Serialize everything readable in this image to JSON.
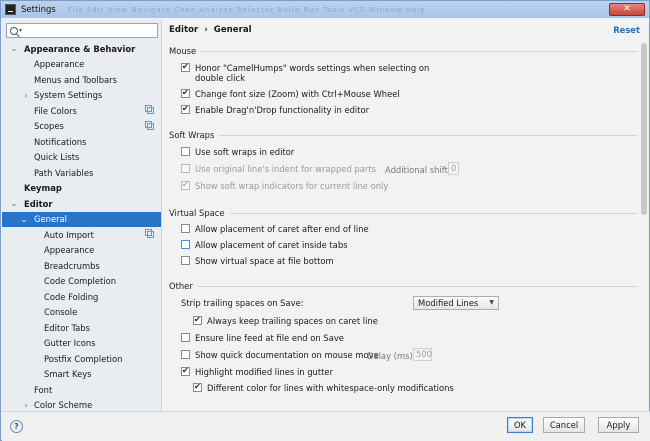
{
  "window": {
    "title": "Settings",
    "ghost_menu": "File  Edit  View  Navigate  Code  Analyze  Refactor  Build  Run  Tools  VCS  Window  Help",
    "close_symbol": "✕"
  },
  "search": {
    "placeholder": ""
  },
  "tree": [
    {
      "label": "Appearance & Behavior",
      "level": 0,
      "bold": true,
      "arrow": "⌄"
    },
    {
      "label": "Appearance",
      "level": 1
    },
    {
      "label": "Menus and Toolbars",
      "level": 1
    },
    {
      "label": "System Settings",
      "level": 1,
      "arrow": "›"
    },
    {
      "label": "File Colors",
      "level": 1,
      "icon": "copy-icon"
    },
    {
      "label": "Scopes",
      "level": 1,
      "icon": "copy-icon"
    },
    {
      "label": "Notifications",
      "level": 1
    },
    {
      "label": "Quick Lists",
      "level": 1
    },
    {
      "label": "Path Variables",
      "level": 1
    },
    {
      "label": "Keymap",
      "level": 0,
      "bold": true
    },
    {
      "label": "Editor",
      "level": 0,
      "bold": true,
      "arrow": "⌄"
    },
    {
      "label": "General",
      "level": 1,
      "arrow": "⌄",
      "selected": true
    },
    {
      "label": "Auto Import",
      "level": 2,
      "icon": "copy-icon"
    },
    {
      "label": "Appearance",
      "level": 2
    },
    {
      "label": "Breadcrumbs",
      "level": 2
    },
    {
      "label": "Code Completion",
      "level": 2
    },
    {
      "label": "Code Folding",
      "level": 2
    },
    {
      "label": "Console",
      "level": 2
    },
    {
      "label": "Editor Tabs",
      "level": 2
    },
    {
      "label": "Gutter Icons",
      "level": 2
    },
    {
      "label": "Postfix Completion",
      "level": 2
    },
    {
      "label": "Smart Keys",
      "level": 2
    },
    {
      "label": "Font",
      "level": 1
    },
    {
      "label": "Color Scheme",
      "level": 1,
      "arrow": "›"
    }
  ],
  "header": {
    "crumb1": "Editor",
    "separator": "›",
    "crumb2": "General",
    "reset": "Reset"
  },
  "sections": {
    "mouse": "Mouse",
    "soft_wraps": "Soft Wraps",
    "virtual_space": "Virtual Space",
    "other": "Other"
  },
  "options": {
    "camel_humps": {
      "label1": "Honor \"CamelHumps\" words settings when selecting on",
      "label2": "double click",
      "checked": true
    },
    "zoom_font": {
      "label": "Change font size (Zoom) with Ctrl+Mouse Wheel",
      "checked": true
    },
    "drag_drop": {
      "label": "Enable Drag'n'Drop functionality in editor",
      "checked": true
    },
    "soft_wraps_editor": {
      "label": "Use soft wraps in editor",
      "checked": false
    },
    "original_indent": {
      "label": "Use original line's indent for wrapped parts",
      "checked": false,
      "disabled": true
    },
    "additional_shift_label": "Additional shift:",
    "additional_shift_value": "0",
    "show_wrap_indicators": {
      "label": "Show soft wrap indicators for current line only",
      "checked": true,
      "disabled": true
    },
    "caret_after_end": {
      "label": "Allow placement of caret after end of line",
      "checked": false
    },
    "caret_inside_tabs": {
      "label": "Allow placement of caret inside tabs",
      "checked": false
    },
    "virtual_space_bottom": {
      "label": "Show virtual space at file bottom",
      "checked": false
    },
    "strip_label": "Strip trailing spaces on Save:",
    "strip_value": "Modified Lines",
    "keep_trailing": {
      "label": "Always keep trailing spaces on caret line",
      "checked": true
    },
    "line_feed": {
      "label": "Ensure line feed at file end on Save",
      "checked": false
    },
    "quick_doc": {
      "label": "Show quick documentation on mouse move",
      "checked": false
    },
    "delay_label": "Delay (ms):",
    "delay_value": "500",
    "highlight_modified": {
      "label": "Highlight modified lines in gutter",
      "checked": true
    },
    "different_color": {
      "label": "Different color for lines with whitespace-only modifications",
      "checked": true
    }
  },
  "footer": {
    "help": "?",
    "ok": "OK",
    "cancel": "Cancel",
    "apply": "Apply"
  },
  "colors": {
    "selection": "#2a74c7",
    "link": "#2a6fb8"
  }
}
